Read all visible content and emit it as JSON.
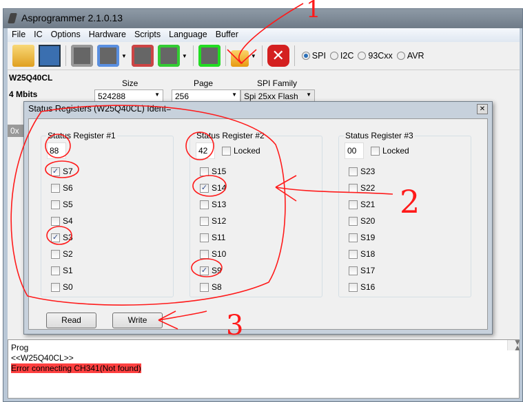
{
  "window": {
    "title": "Asprogrammer 2.1.0.13"
  },
  "menu": [
    "File",
    "IC",
    "Options",
    "Hardware",
    "Scripts",
    "Language",
    "Buffer"
  ],
  "toolbar": {
    "icons": [
      "open-icon",
      "save-icon",
      "read-chip-icon",
      "write-chip-icon",
      "erase-chip-icon",
      "verify-chip-icon",
      "check-blank-icon",
      "lock-icon",
      "stop-icon"
    ],
    "protocols": [
      {
        "label": "SPI",
        "selected": true
      },
      {
        "label": "I2C",
        "selected": false
      },
      {
        "label": "93Cxx",
        "selected": false
      },
      {
        "label": "AVR",
        "selected": false
      }
    ]
  },
  "chip": {
    "name": "W25Q40CL",
    "size_text": "4 Mbits",
    "size_label": "Size",
    "size_value": "524288",
    "page_label": "Page",
    "page_value": "256",
    "family_label": "SPI Family",
    "family_value": "Spi 25xx Flash"
  },
  "hex_hint": "0x",
  "dialog": {
    "title": "Status Registers (W25Q40CL) Ident=",
    "registers": [
      {
        "title": "Status Register #1",
        "value": "88",
        "locked": null,
        "bits": [
          {
            "n": "S7",
            "c": true
          },
          {
            "n": "S6",
            "c": false
          },
          {
            "n": "S5",
            "c": false
          },
          {
            "n": "S4",
            "c": false
          },
          {
            "n": "S3",
            "c": true
          },
          {
            "n": "S2",
            "c": false
          },
          {
            "n": "S1",
            "c": false
          },
          {
            "n": "S0",
            "c": false
          }
        ]
      },
      {
        "title": "Status Register #2",
        "value": "42",
        "locked": false,
        "bits": [
          {
            "n": "S15",
            "c": false
          },
          {
            "n": "S14",
            "c": true
          },
          {
            "n": "S13",
            "c": false
          },
          {
            "n": "S12",
            "c": false
          },
          {
            "n": "S11",
            "c": false
          },
          {
            "n": "S10",
            "c": false
          },
          {
            "n": "S9",
            "c": true
          },
          {
            "n": "S8",
            "c": false
          }
        ]
      },
      {
        "title": "Status Register #3",
        "value": "00",
        "locked": false,
        "bits": [
          {
            "n": "S23",
            "c": false
          },
          {
            "n": "S22",
            "c": false
          },
          {
            "n": "S21",
            "c": false
          },
          {
            "n": "S20",
            "c": false
          },
          {
            "n": "S19",
            "c": false
          },
          {
            "n": "S18",
            "c": false
          },
          {
            "n": "S17",
            "c": false
          },
          {
            "n": "S16",
            "c": false
          }
        ]
      }
    ],
    "locked_label": "Locked",
    "read_label": "Read",
    "write_label": "Write"
  },
  "log": [
    "Prog",
    "<<W25Q40CL>>",
    "Error connecting CH341(Not found)"
  ],
  "annotations": [
    "1",
    "2",
    "3"
  ]
}
